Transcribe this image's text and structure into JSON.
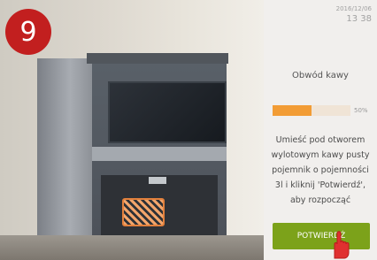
{
  "step": {
    "number": "9"
  },
  "panel": {
    "date": "2016/12/06",
    "time": "13 38",
    "title": "Obwód kawy",
    "progress": {
      "value": 50,
      "label": "50%"
    },
    "instruction": "Umieść pod otworem wylotowym kawy pusty pojemnik o pojemności 3l i kliknij 'Potwierdź', aby rozpocząć",
    "confirm_label": "POTWIERDŹ"
  },
  "colors": {
    "step_badge": "#c21f1f",
    "progress_fill": "#f29c35",
    "confirm_button": "#7ca21a",
    "hand_cursor": "#e03030"
  },
  "icons": {
    "cursor": "hand-pointer-icon"
  }
}
